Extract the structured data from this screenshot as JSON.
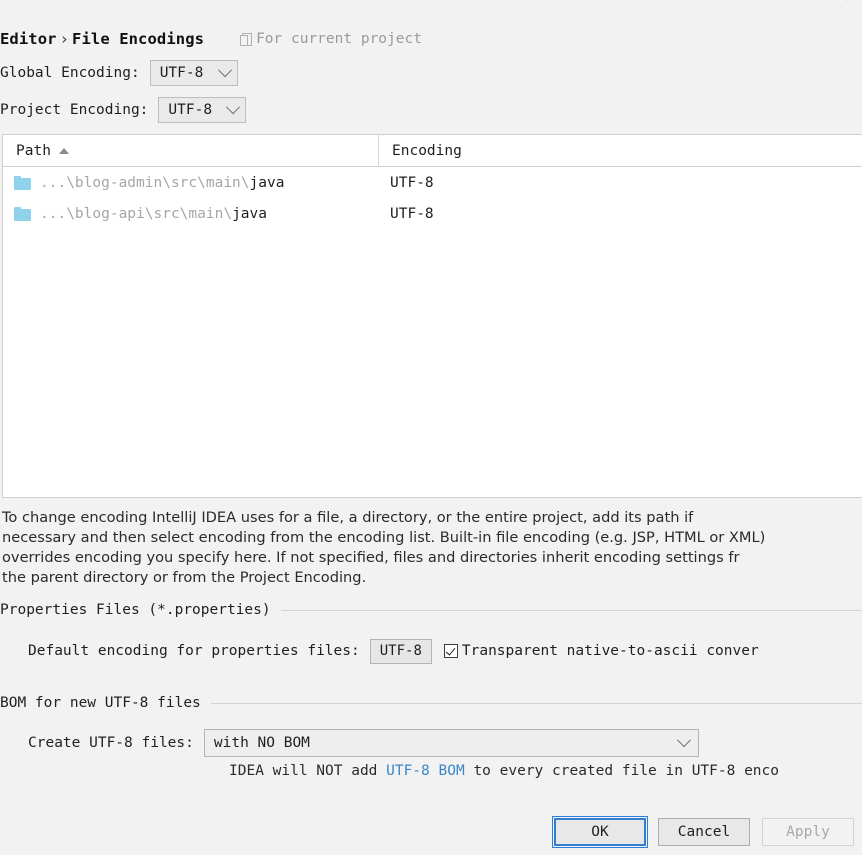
{
  "dialog": {
    "close_label": "×"
  },
  "header": {
    "breadcrumb_parent": "Editor",
    "breadcrumb_separator": "›",
    "breadcrumb_current": "File Encodings",
    "scope_note": "For current project",
    "scope_icon": "copy-icon"
  },
  "encodings": {
    "global_label": "Global Encoding:",
    "global_value": "UTF-8",
    "project_label": "Project Encoding:",
    "project_value": "UTF-8"
  },
  "table": {
    "columns": [
      "Path",
      "Encoding"
    ],
    "sort_column": "Path",
    "sort_direction": "asc",
    "rows": [
      {
        "path_prefix": "...\\blog-admin\\src\\main\\",
        "path_name": "java",
        "encoding": "UTF-8"
      },
      {
        "path_prefix": "...\\blog-api\\src\\main\\",
        "path_name": "java",
        "encoding": "UTF-8"
      }
    ]
  },
  "description": "To change encoding IntelliJ IDEA uses for a file, a directory, or the entire project, add its path if\nnecessary and then select encoding from the encoding list. Built-in file encoding (e.g. JSP, HTML or XML)\noverrides encoding you specify here. If not specified, files and directories inherit encoding settings fr\nthe parent directory or from the Project Encoding.",
  "properties_section": {
    "title": "Properties Files (*.properties)",
    "default_encoding_label": "Default encoding for properties files:",
    "default_encoding_value": "UTF-8",
    "transparent_checkbox_label": "Transparent native-to-ascii conver",
    "transparent_checked": true
  },
  "bom_section": {
    "title": "BOM for new UTF-8 files",
    "create_label": "Create UTF-8 files:",
    "create_value": "with NO BOM",
    "note_prefix": "IDEA will NOT add ",
    "note_link": "UTF-8 BOM",
    "note_suffix": " to every created file in UTF-8 enco"
  },
  "footer": {
    "ok_label": "OK",
    "cancel_label": "Cancel",
    "apply_label": "Apply",
    "apply_disabled": true
  },
  "colors": {
    "background": "#f2f2f2",
    "accent_blue": "#2f7fd4",
    "link_blue": "#3b86c9",
    "folder_blue": "#8ed2ec",
    "muted_text": "#a6a6a6"
  }
}
